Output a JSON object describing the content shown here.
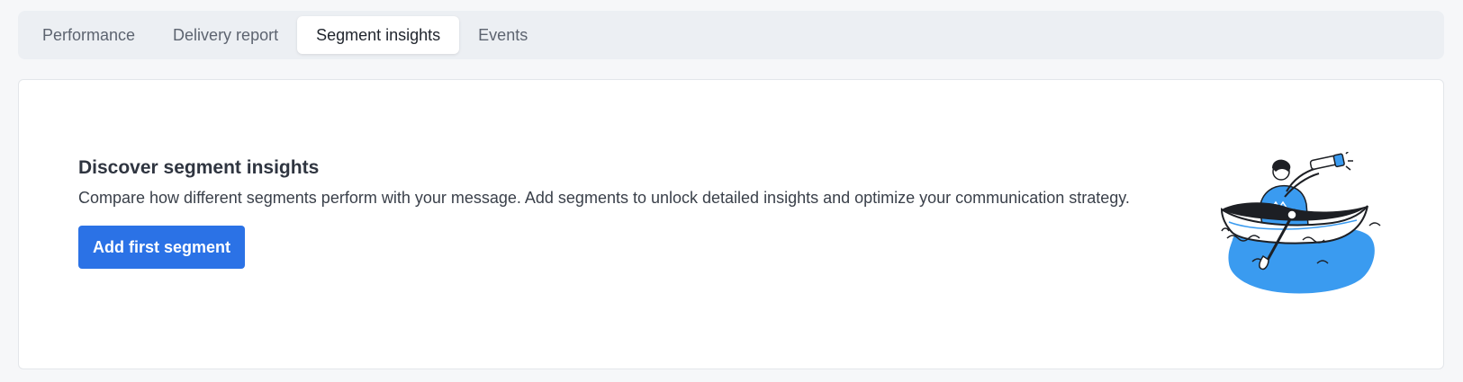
{
  "tabs": [
    {
      "label": "Performance",
      "active": false
    },
    {
      "label": "Delivery report",
      "active": false
    },
    {
      "label": "Segment insights",
      "active": true
    },
    {
      "label": "Events",
      "active": false
    }
  ],
  "empty_state": {
    "title": "Discover segment insights",
    "description": "Compare how different segments perform with your message. Add segments to unlock detailed insights and optimize your communication strategy.",
    "button_label": "Add first segment",
    "illustration": "person-in-boat-with-telescope-illustration"
  },
  "colors": {
    "accent": "#2b72e6",
    "illustration_blue": "#3a9bf0",
    "tab_bar_bg": "#eceff3"
  }
}
